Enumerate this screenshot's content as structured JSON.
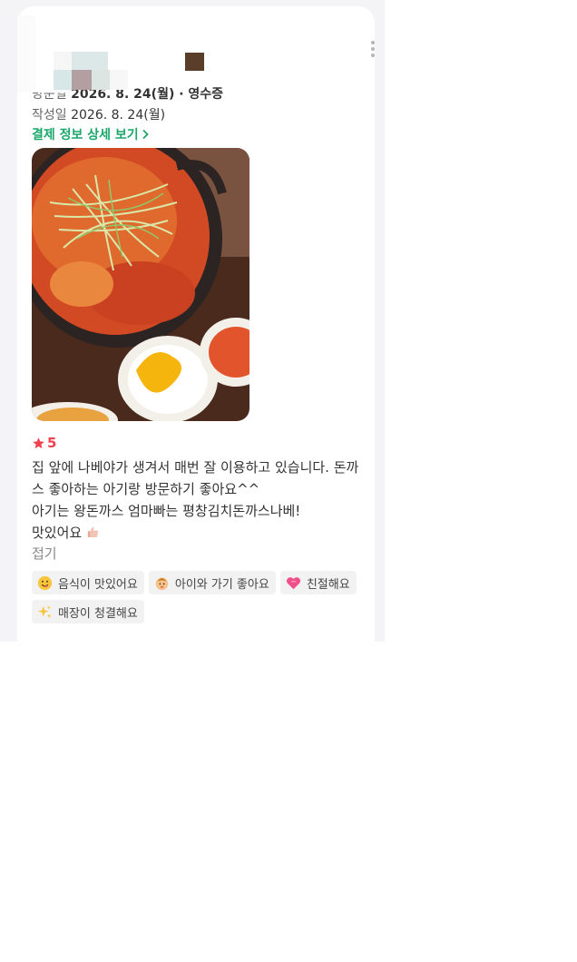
{
  "header": {
    "visit_label": "방문일",
    "visit_value": "2026. 8. 24(월) · 영수증"
  },
  "written": {
    "label": "작성일",
    "value": "2026. 8. 24(월)"
  },
  "payment_link": "결제 정보 상세 보기",
  "rating": "5",
  "review": {
    "line1": "집 앞에 나베야가 생겨서 매번 잘 이용하고 있습니다. 돈까스 좋아하는 아기랑 방문하기 좋아요^^",
    "line2": "아기는 왕돈까스 엄마빠는 평창김치돈까스나베!",
    "line3": "맛있어요"
  },
  "collapse_label": "접기",
  "tags": [
    {
      "label": "음식이 맛있어요",
      "icon": "yum-face-icon"
    },
    {
      "label": "아이와 가기 좋아요",
      "icon": "baby-face-icon"
    },
    {
      "label": "친절해요",
      "icon": "heart-icon"
    },
    {
      "label": "매장이 청결해요",
      "icon": "sparkles-icon"
    }
  ],
  "colors": {
    "accent_green": "#1aa86a",
    "star_red": "#f0414f",
    "tag_bg": "#f2f2f2"
  }
}
